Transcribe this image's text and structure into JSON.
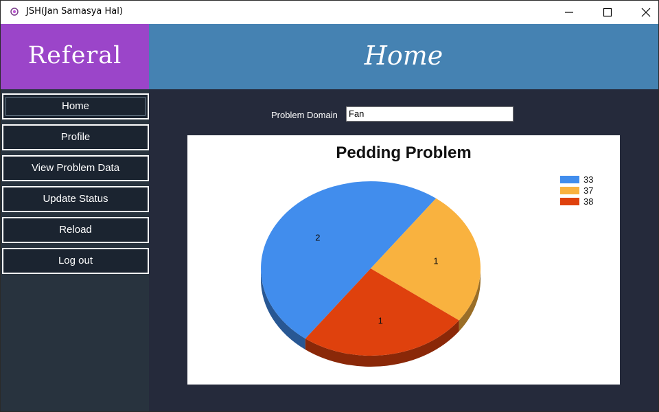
{
  "window": {
    "title": "JSH(Jan Samasya Hal)",
    "controls": [
      "minimize",
      "maximize",
      "close"
    ]
  },
  "brand": {
    "text": "Referal",
    "color": "#9b45c9"
  },
  "header": {
    "title": "Home",
    "color": "#4582b2"
  },
  "sidebar": {
    "items": [
      {
        "label": "Home",
        "active": true
      },
      {
        "label": "Profile"
      },
      {
        "label": "View Problem Data"
      },
      {
        "label": "Update Status"
      },
      {
        "label": "Reload"
      },
      {
        "label": "Log out"
      }
    ]
  },
  "form": {
    "problem_domain_label": "Problem Domain",
    "problem_domain_value": "Fan"
  },
  "chart_data": {
    "type": "pie",
    "title": "Pedding Problem",
    "legend_position": "top-right",
    "categories": [
      "33",
      "37",
      "38"
    ],
    "values": [
      2,
      1,
      1
    ],
    "colors": [
      "#418ded",
      "#f9b23f",
      "#df410d"
    ]
  }
}
